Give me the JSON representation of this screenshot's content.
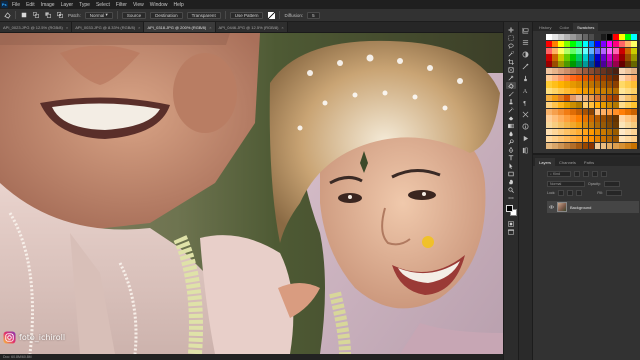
{
  "app": {
    "menu": [
      "File",
      "Edit",
      "Image",
      "Layer",
      "Type",
      "Select",
      "Filter",
      "View",
      "Window",
      "Help"
    ]
  },
  "options_bar": {
    "patch_label": "Patch:",
    "patch_mode": "Normal",
    "source_label": "Source",
    "destination_label": "Destination",
    "transparent_label": "Transparent",
    "use_pattern_label": "Use Pattern",
    "diffusion_label": "Diffusion:",
    "diffusion_value": "5"
  },
  "doc_tabs": [
    {
      "label": "API_0023.JPG @ 12.5% (RGB/8)",
      "active": false
    },
    {
      "label": "API_0033.JPG @ 8.33% (RGB/8)",
      "active": false
    },
    {
      "label": "API_0318.JPG @ 200% (RGB/8)",
      "active": true
    },
    {
      "label": "API_0446.JPG @ 12.5% (RGB/8)",
      "active": false
    }
  ],
  "status_bar": {
    "text": "Doc: 60.8M/60.8M"
  },
  "swatches_panel": {
    "tabs": [
      {
        "label": "History",
        "active": false
      },
      {
        "label": "Color",
        "active": false
      },
      {
        "label": "Swatches",
        "active": true
      }
    ]
  },
  "layers_panel": {
    "tabs": [
      {
        "label": "Layers",
        "active": true
      },
      {
        "label": "Channels",
        "active": false
      },
      {
        "label": "Paths",
        "active": false
      }
    ],
    "kind_label": "Kind",
    "blend_mode": "Normal",
    "opacity_label": "Opacity:",
    "lock_label": "Lock:",
    "fill_label": "Fill:",
    "layers": [
      {
        "name": "Background",
        "visible": true
      }
    ]
  },
  "watermark": {
    "text": "foto_ichiroll"
  },
  "colors": {
    "app_bg": "#282828",
    "panel_bg": "#323232",
    "active_layer": "#454545",
    "foreground": "#000000",
    "background": "#ffffff"
  },
  "swatch_colors": [
    [
      "#ffffff",
      "#e6e6e6",
      "#cccccc",
      "#b3b3b3",
      "#999999",
      "#808080",
      "#666666",
      "#4d4d4d",
      "#333333",
      "#1a1a1a",
      "#000000",
      "#ff0000",
      "#ffff00",
      "#00ff00",
      "#00ffff"
    ],
    [
      "#ff0000",
      "#ff8000",
      "#ffff00",
      "#80ff00",
      "#00ff00",
      "#00ff80",
      "#00ffff",
      "#0080ff",
      "#0000ff",
      "#8000ff",
      "#ff00ff",
      "#ff0080",
      "#ff6666",
      "#ffb366",
      "#ffff66"
    ],
    [
      "#ff6666",
      "#ffb366",
      "#ffff66",
      "#b3ff66",
      "#66ff66",
      "#66ffb3",
      "#66ffff",
      "#66b3ff",
      "#6666ff",
      "#b366ff",
      "#ff66ff",
      "#ff66b3",
      "#cc0000",
      "#cc6600",
      "#cccc00"
    ],
    [
      "#cc0000",
      "#cc6600",
      "#cccc00",
      "#66cc00",
      "#00cc00",
      "#00cc66",
      "#00cccc",
      "#0066cc",
      "#0000cc",
      "#6600cc",
      "#cc00cc",
      "#cc0066",
      "#990000",
      "#994c00",
      "#999900"
    ],
    [
      "#990000",
      "#994c00",
      "#999900",
      "#4c9900",
      "#009900",
      "#00994c",
      "#009999",
      "#004c99",
      "#000099",
      "#4c0099",
      "#990099",
      "#99004c",
      "#660000",
      "#663300",
      "#666600"
    ],
    [
      "#f2c6a0",
      "#e8b48a",
      "#dca07a",
      "#cf8f6a",
      "#c07c58",
      "#b06a48",
      "#9c5a3c",
      "#8a4c32",
      "#7a4028",
      "#6a3420",
      "#5a2a18",
      "#4a2012",
      "#f7d7b5",
      "#efc49b",
      "#e4b083"
    ],
    [
      "#ffcc99",
      "#ffb380",
      "#ff9966",
      "#ff8040",
      "#ff6619",
      "#f25c05",
      "#e05500",
      "#cc4d00",
      "#b34400",
      "#993a00",
      "#803000",
      "#662600",
      "#ffd9b3",
      "#ffc08c",
      "#ffa866"
    ],
    [
      "#ffcc33",
      "#ffbf1a",
      "#ffb300",
      "#f2a600",
      "#e69900",
      "#d98c00",
      "#cc8000",
      "#bf7300",
      "#b36600",
      "#a65900",
      "#994d00",
      "#8c4000",
      "#ffd966",
      "#ffcc4d",
      "#ffbf33"
    ],
    [
      "#ffe080",
      "#ffd466",
      "#ffc84d",
      "#ffbb33",
      "#ffaf1a",
      "#ffa200",
      "#f29900",
      "#e69000",
      "#d98700",
      "#cc7e00",
      "#bf7500",
      "#b36c00",
      "#ffe699",
      "#ffdb80",
      "#ffd166"
    ],
    [
      "#f5b041",
      "#f39c12",
      "#e67e22",
      "#d35400",
      "#e59866",
      "#edbb99",
      "#f0b27a",
      "#eb984e",
      "#dc7633",
      "#ca6f1e",
      "#ba4a00",
      "#a04000",
      "#fad7a0",
      "#f8c471",
      "#f5b041"
    ],
    [
      "#ffd27f",
      "#ffc34d",
      "#ffb41a",
      "#e6a000",
      "#cc8e00",
      "#b37d00",
      "#ffcf70",
      "#ffbe3d",
      "#ffad0a",
      "#e69a00",
      "#cc8900",
      "#b37800",
      "#ffdc8a",
      "#ffcf5c",
      "#ffc22e"
    ],
    [
      "#f8b26a",
      "#f6a04d",
      "#f48e30",
      "#f27c13",
      "#e06d05",
      "#c45f04",
      "#a85103",
      "#8c4403",
      "#ffc285",
      "#ffb166",
      "#ffa047",
      "#ff8f28",
      "#ff7e09",
      "#e87000",
      "#cc6300"
    ],
    [
      "#ffcf99",
      "#ffbf7a",
      "#ffaf5c",
      "#ff9f3d",
      "#ff8f1f",
      "#ff7f00",
      "#e67200",
      "#cc6600",
      "#b35900",
      "#994d00",
      "#804000",
      "#663300",
      "#ffd6a6",
      "#ffc785",
      "#ffb866"
    ],
    [
      "#f9d89c",
      "#f7cc80",
      "#f5c064",
      "#f3b448",
      "#f1a82c",
      "#ef9c10",
      "#d98b0c",
      "#c37a0a",
      "#ad6a08",
      "#975a06",
      "#814a04",
      "#6b3a02",
      "#fbe4b8",
      "#f9d89c",
      "#f7cc80"
    ],
    [
      "#ffe0b3",
      "#ffd699",
      "#ffcc80",
      "#ffc266",
      "#ffb84d",
      "#ffad33",
      "#ffa31a",
      "#ff9900",
      "#e68a00",
      "#cc7a00",
      "#b36b00",
      "#995c00",
      "#ffe8c7",
      "#ffdead",
      "#ffd494"
    ],
    [
      "#ffd9a0",
      "#ffcf8a",
      "#ffc473",
      "#ffba5c",
      "#ffaf45",
      "#ffa52e",
      "#ff9a17",
      "#ff9000",
      "#e58100",
      "#cc7200",
      "#b26400",
      "#995500",
      "#ffe3b8",
      "#ffd9a0",
      "#ffcf8a"
    ],
    [
      "#e6b980",
      "#d9a66a",
      "#cc9354",
      "#bf803e",
      "#b26d28",
      "#a55a12",
      "#984700",
      "#8b3400",
      "#f2cc99",
      "#ebbd80",
      "#e4ae66",
      "#dd9f4d",
      "#d69033",
      "#cf811a",
      "#c87200"
    ]
  ]
}
